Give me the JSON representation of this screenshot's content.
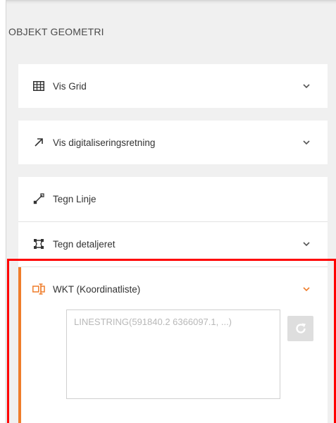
{
  "panel": {
    "title": "OBJEKT GEOMETRI"
  },
  "items": {
    "vis_grid": {
      "label": "Vis Grid",
      "icon": "grid-icon"
    },
    "vis_retning": {
      "label": "Vis digitaliseringsretning",
      "icon": "arrow-up-right-icon"
    },
    "tegn_linje": {
      "label": "Tegn Linje",
      "icon": "draw-line-icon"
    },
    "tegn_detaljeret": {
      "label": "Tegn detaljeret",
      "icon": "polygon-nodes-icon"
    },
    "wkt": {
      "label": "WKT (Koordinatliste)",
      "icon": "text-cursor-icon",
      "placeholder": "LINESTRING(591840.2 6366097.1, ...)",
      "value": ""
    }
  },
  "colors": {
    "accent": "#ef7d2b",
    "highlight": "#ff0000",
    "panel_bg": "#f0f0f0"
  }
}
